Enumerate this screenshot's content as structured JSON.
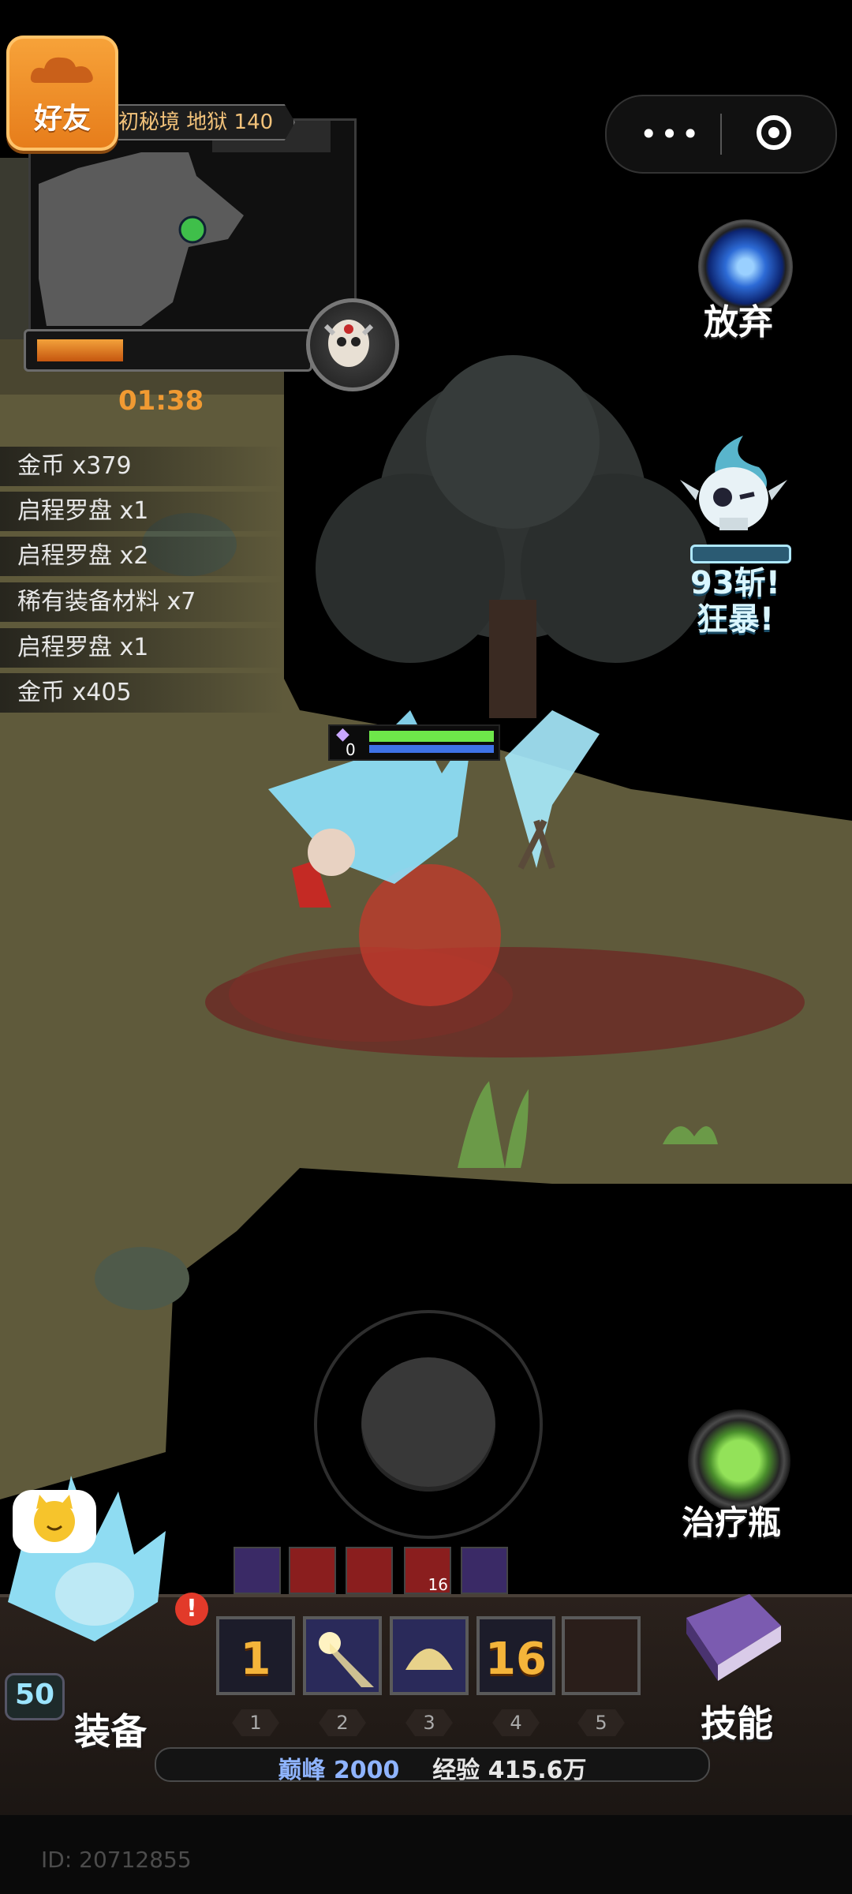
{
  "hud": {
    "friend_button": "好友",
    "map_title": "初秘境 地狱 140",
    "timer": "01:38",
    "timer_progress": 0.33
  },
  "loot_log": [
    {
      "text": "金币  x379"
    },
    {
      "text": "启程罗盘  x1"
    },
    {
      "text": "启程罗盘  x2"
    },
    {
      "text": "稀有装备材料  x7"
    },
    {
      "text": "启程罗盘  x1"
    },
    {
      "text": "金币  x405"
    }
  ],
  "right_panel": {
    "abandon_label": "放弃",
    "rage_line1": "93斩!",
    "rage_line2": "狂暴!",
    "potion_label": "治疗瓶"
  },
  "player": {
    "level_indicator": "0",
    "hp_fraction": 1.0,
    "mp_fraction": 1.0
  },
  "buffs": [
    {
      "icon": "purple-diamond-icon",
      "stack": ""
    },
    {
      "icon": "red-banner-icon",
      "stack": ""
    },
    {
      "icon": "red-banner-icon",
      "stack": ""
    },
    {
      "icon": "red-banner-icon",
      "stack": "16"
    },
    {
      "icon": "purple-slash-icon",
      "stack": ""
    }
  ],
  "skill_slots": [
    {
      "num": "1",
      "value": "1"
    },
    {
      "num": "2",
      "value": ""
    },
    {
      "num": "3",
      "value": ""
    },
    {
      "num": "4",
      "value": "16"
    },
    {
      "num": "5",
      "value": ""
    }
  ],
  "bottom": {
    "equip_label": "装备",
    "skill_label": "技能",
    "char_level": "50",
    "alert": "!",
    "peak_label": "巅峰",
    "peak_value": "2000",
    "xp_label": "经验",
    "xp_value": "415.6万",
    "id_text": "ID: 20712855"
  },
  "colors": {
    "accent_orange": "#f09a32",
    "hp_green": "#6ee74a",
    "mp_blue": "#3e72e6",
    "grass": "#5f5a3b"
  }
}
